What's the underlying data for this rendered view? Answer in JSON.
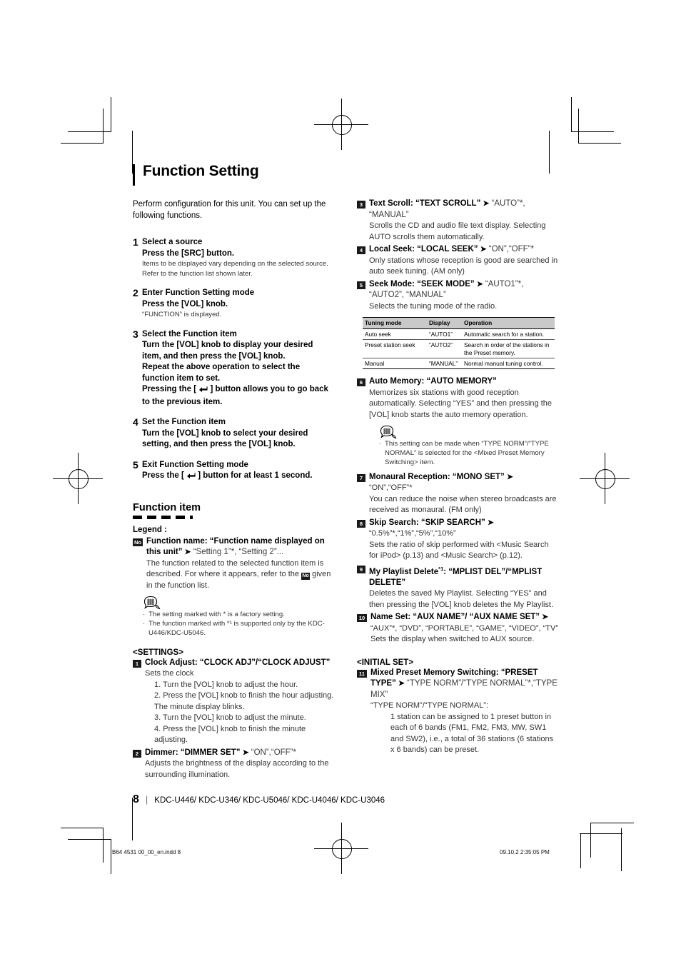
{
  "document": {
    "title": "Function Setting",
    "intro": "Perform configuration for this unit. You can set up the following functions.",
    "page_number": "8",
    "models": "KDC-U446/ KDC-U346/ KDC-U5046/ KDC-U4046/ KDC-U3046",
    "imprint_file": "B64 4531 00_00_en.indd   8",
    "imprint_date": "09.10.2   2:35:05 PM"
  },
  "steps": [
    {
      "num": "1",
      "title": "Select a source",
      "title2": "Press the [SRC] button.",
      "sub": "Items to be displayed vary depending on the selected source. Refer to the function list shown later."
    },
    {
      "num": "2",
      "title": "Enter Function Setting mode",
      "title2": "Press the [VOL] knob.",
      "sub": "“FUNCTION” is displayed."
    },
    {
      "num": "3",
      "title": "Select the Function item",
      "title2": "Turn the [VOL] knob to display your desired item, and then press the [VOL] knob.",
      "title3": "Repeat the above operation to select the function item to set.",
      "title4_a": "Pressing the [ ",
      "title4_b": " ] button allows you to go back to the previous item.",
      "sub": ""
    },
    {
      "num": "4",
      "title": "Set the Function item",
      "title2": "Turn the [VOL] knob to select your desired setting, and then press the [VOL] knob.",
      "sub": ""
    },
    {
      "num": "5",
      "title": "Exit Function Setting mode",
      "title2_a": "Press the [ ",
      "title2_b": " ] button for at least 1 second.",
      "sub": ""
    }
  ],
  "function_item": {
    "heading": "Function item",
    "legend_label": "Legend :",
    "legend_badge": "No",
    "legend_title_a": "Function name: “Function name displayed on this unit”",
    "legend_title_arrow": "➤",
    "legend_title_opts": "“Setting 1”*, “Setting 2”...",
    "legend_desc_a": "The function related to the selected function item is described. For where it appears, refer to the",
    "legend_desc_b": "given in the function list.",
    "notes": [
      "The setting marked with * is a factory setting.",
      "The function marked with *¹ is supported only by the KDC-U446/KDC-U5046."
    ]
  },
  "settings_heading": "<SETTINGS>",
  "initial_set_heading": "<INITIAL SET>",
  "settings": [
    {
      "num": "1",
      "title": "Clock Adjust: “CLOCK ADJ”/“CLOCK ADJUST”",
      "desc": "Sets the clock",
      "substeps": [
        "1. Turn the [VOL] knob to adjust the hour.",
        "2. Press the [VOL] knob to finish the hour adjusting. The minute display blinks.",
        "3. Turn the [VOL] knob to adjust the minute.",
        "4. Press the [VOL] knob to finish the minute adjusting."
      ]
    },
    {
      "num": "2",
      "title": "Dimmer: “DIMMER SET”",
      "options": "“ON”,“OFF”*",
      "desc": "Adjusts the brightness of the display according to the surrounding illumination."
    },
    {
      "num": "3",
      "title": "Text Scroll: “TEXT SCROLL”",
      "options": "“AUTO”*, “MANUAL”",
      "desc": "Scrolls the CD and audio file text display. Selecting AUTO scrolls them automatically."
    },
    {
      "num": "4",
      "title": "Local Seek: “LOCAL SEEK”",
      "options": "“ON”,“OFF”*",
      "desc": "Only stations whose reception is good are searched in auto seek tuning. (AM only)"
    },
    {
      "num": "5",
      "title": "Seek Mode: “SEEK MODE”",
      "options": "“AUTO1”*, “AUTO2”, “MANUAL”",
      "desc": "Selects the tuning mode of the radio."
    },
    {
      "num": "6",
      "title": "Auto Memory: “AUTO MEMORY”",
      "options": "",
      "desc": "Memorizes six stations with good reception automatically. Selecting “YES” and then pressing the [VOL] knob starts the auto memory operation.",
      "note": "This setting can be made when “TYPE NORM”/“TYPE NORMAL” is selected for the <Mixed Preset Memory Switching> item."
    },
    {
      "num": "7",
      "title": "Monaural Reception: “MONO SET”",
      "options": "“ON”,“OFF”*",
      "desc": "You can reduce the noise when stereo broadcasts are received as monaural. (FM only)"
    },
    {
      "num": "8",
      "title": "Skip Search: “SKIP SEARCH”",
      "options": "“0.5%”*,“1%”,“5%”,“10%”",
      "desc": "Sets the ratio of skip performed with <Music Search for iPod> (p.13) and <Music Search> (p.12)."
    },
    {
      "num": "9",
      "title_a": "My Playlist Delete",
      "title_sup": "*1",
      "title_b": ": “MPLIST DEL”/“MPLIST DELETE”",
      "desc": "Deletes the saved My Playlist. Selecting “YES” and then pressing the [VOL] knob deletes the My Playlist."
    },
    {
      "num": "10",
      "title": "Name Set: “AUX NAME”/ “AUX NAME SET”",
      "options": "“AUX”*, “DVD”, “PORTABLE”, “GAME”, “VIDEO”, “TV”",
      "desc": "Sets the display when switched to AUX source."
    },
    {
      "num": "11",
      "title": "Mixed Preset Memory Switching: “PRESET TYPE”",
      "options": "“TYPE NORM”/“TYPE NORMAL”*,“TYPE MIX”",
      "desc_lead": "“TYPE NORM”/“TYPE NORMAL”:",
      "desc_indent": "1 station can be assigned to 1 preset button in each of 6 bands (FM1, FM2, FM3, MW, SW1 and SW2), i.e., a total of 36 stations (6 stations x 6 bands) can be preset."
    }
  ],
  "tuning_table": {
    "headers": [
      "Tuning mode",
      "Display",
      "Operation"
    ],
    "rows": [
      [
        "Auto seek",
        "“AUTO1”",
        "Automatic search for a station."
      ],
      [
        "Preset station seek",
        "“AUTO2”",
        "Search in order of the stations in the Preset memory."
      ],
      [
        "Manual",
        "“MANUAL”",
        "Normal manual tuning control."
      ]
    ]
  }
}
